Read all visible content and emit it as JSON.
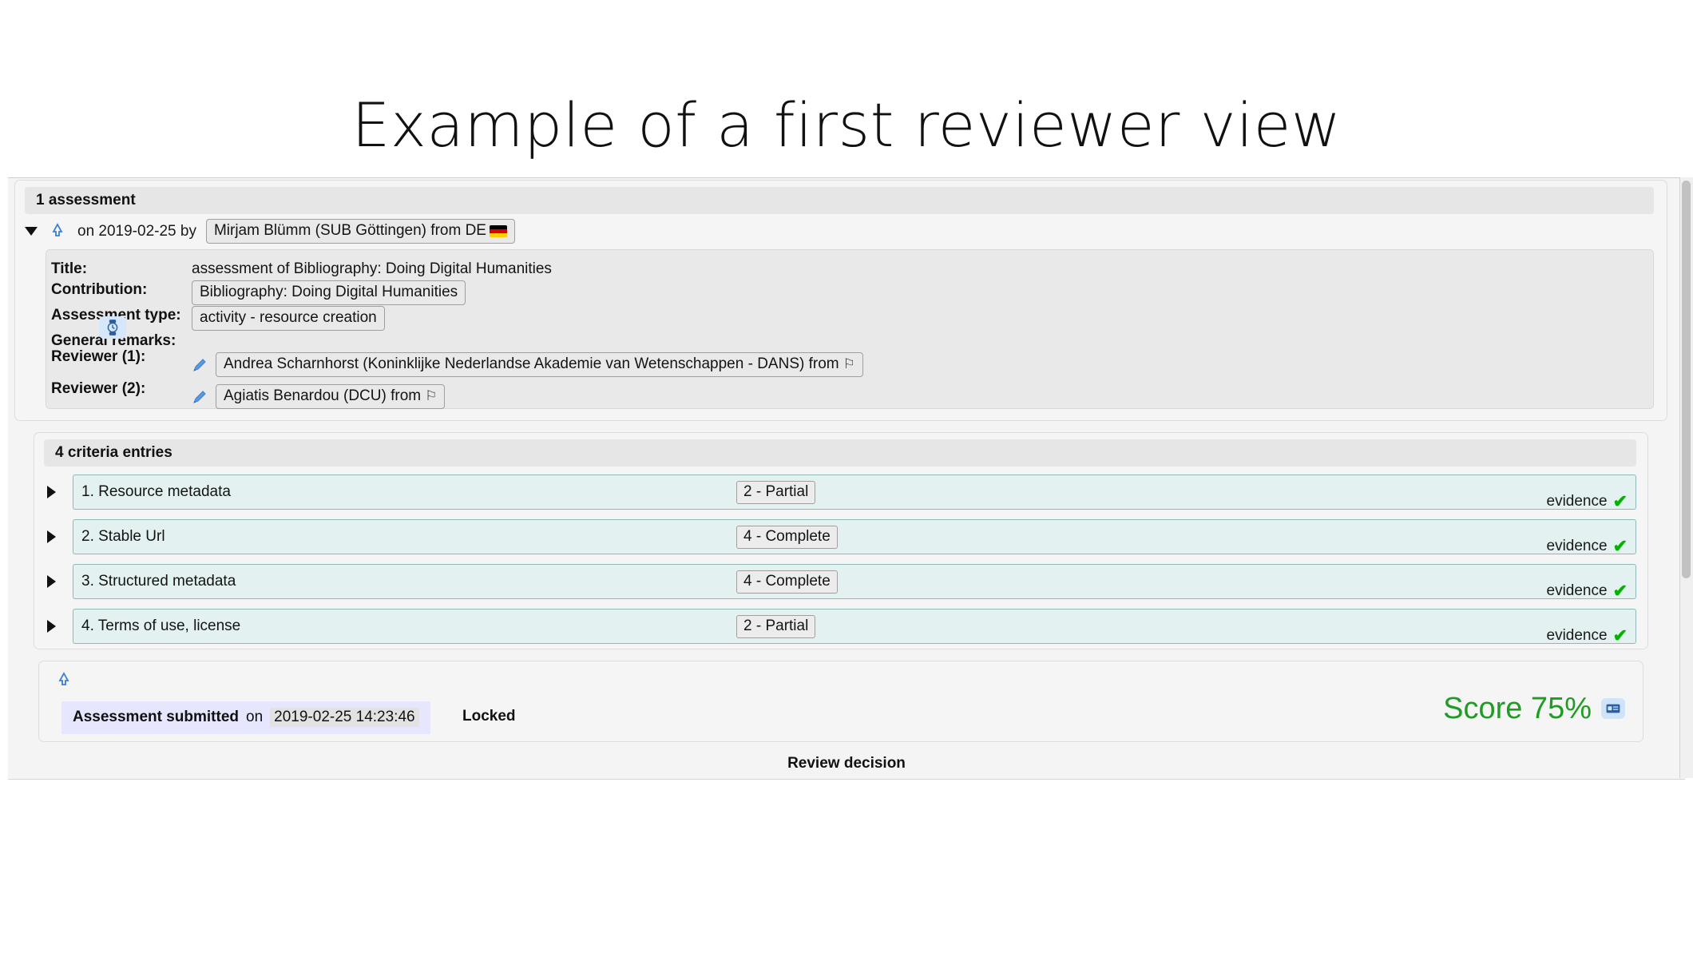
{
  "slide": {
    "title": "Example of a first reviewer view"
  },
  "assessment": {
    "band_label": "1 assessment",
    "header": {
      "toggle_icon": "triangle-down-icon",
      "status_icon": "recycle-icon",
      "date_prefix": "on 2019-02-25 by",
      "author": "Mirjam Blümm (SUB Göttingen) from DE",
      "author_flag": "flag-de"
    },
    "fields": [
      {
        "label": "Title:",
        "value": "assessment of Bibliography: Doing Digital Humanities",
        "style": "plain"
      },
      {
        "label": "Contribution:",
        "value": "Bibliography: Doing Digital Humanities",
        "style": "pill"
      },
      {
        "label": "Assessment type:",
        "value": "activity - resource creation",
        "style": "pill"
      },
      {
        "label": "General remarks:",
        "value": "",
        "style": "plain"
      },
      {
        "label": "Reviewer (1):",
        "value": "Andrea Scharnhorst (Koninklijke Nederlandse Akademie van Wetenschappen - DANS) from",
        "style": "pill-edit",
        "flag": "⚐"
      },
      {
        "label": "Reviewer (2):",
        "value": "Agiatis Benardou (DCU) from",
        "style": "pill-edit",
        "flag": "⚐"
      }
    ],
    "watch_icon": "watch-icon"
  },
  "criteria": {
    "band_label": "4 criteria entries",
    "evidence_label": "evidence",
    "rows": [
      {
        "toggle_icon": "triangle-right-icon",
        "title": "1. Resource metadata",
        "score": "2 - Partial",
        "evidence": true
      },
      {
        "toggle_icon": "triangle-right-icon",
        "title": "2. Stable Url",
        "score": "4 - Complete",
        "evidence": true
      },
      {
        "toggle_icon": "triangle-right-icon",
        "title": "3. Structured metadata",
        "score": "4 - Complete",
        "evidence": true
      },
      {
        "toggle_icon": "triangle-right-icon",
        "title": "4. Terms of use, license",
        "score": "2 - Partial",
        "evidence": true
      }
    ]
  },
  "submission": {
    "status_icon": "recycle-icon",
    "submitted_label": "Assessment submitted",
    "submitted_prefix": "on",
    "submitted_timestamp": "2019-02-25 14:23:46",
    "locked_label": "Locked",
    "score_label": "Score 75%",
    "score_badge_icon": "card-badge-icon"
  },
  "footer": {
    "review_decision_label": "Review decision"
  },
  "colors": {
    "criteria_row_bg": "#e3f1f0",
    "criteria_row_border": "#8fb7b6",
    "score_green": "#1f9c23",
    "submitted_chip_bg": "#e6e6ff",
    "icon_blue": "#3b7dd8"
  }
}
